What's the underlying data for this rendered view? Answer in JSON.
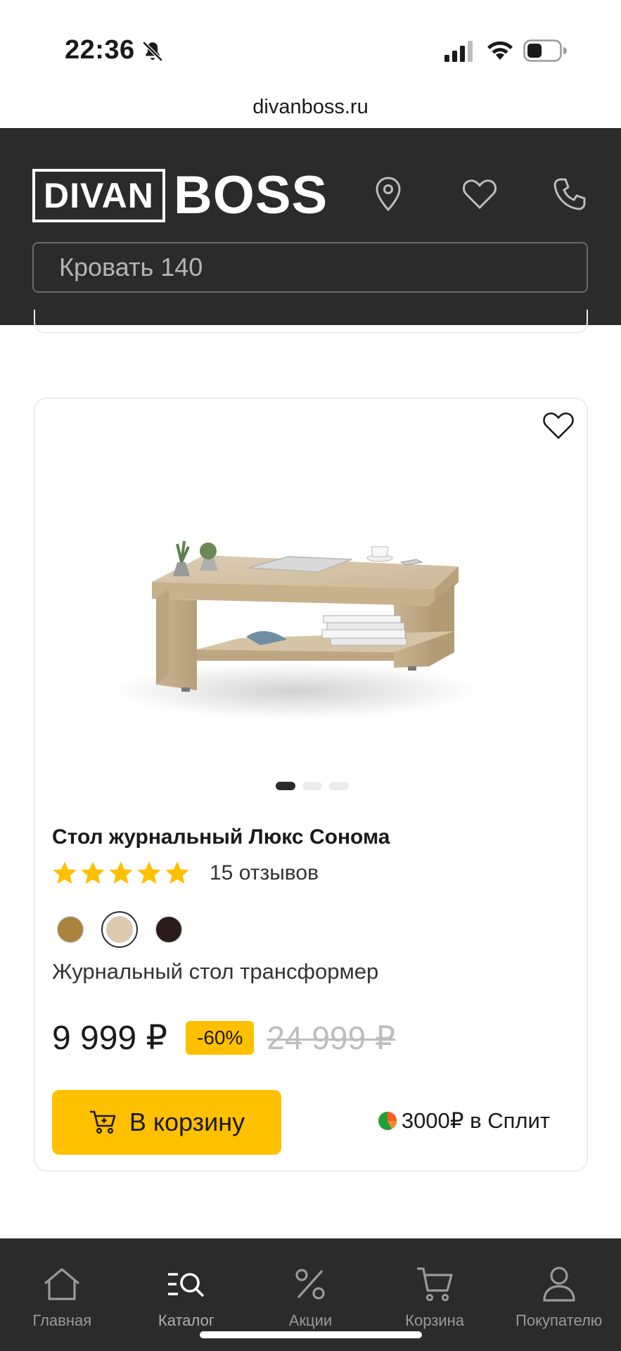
{
  "status_bar": {
    "time": "22:36",
    "icons": [
      "bell-slash-icon",
      "signal-icon",
      "wifi-icon",
      "battery-icon"
    ]
  },
  "browser": {
    "url": "divanboss.ru"
  },
  "header": {
    "logo_box_text": "DIVAN",
    "logo_text": "BOSS",
    "icons": [
      "location-pin-icon",
      "heart-icon",
      "phone-icon"
    ],
    "search_placeholder": "Кровать 140",
    "background_color": "#2b2b2b"
  },
  "product": {
    "title": "Стол журнальный Люкс Сонома",
    "rating": 5,
    "reviews": "15 отзывов",
    "image_slides": 3,
    "active_slide": 1,
    "colors": [
      {
        "hex": "#a9823d",
        "selected": false
      },
      {
        "hex": "#dfc9ad",
        "selected": true
      },
      {
        "hex": "#2a1c1a",
        "selected": false
      }
    ],
    "description": "Журнальный стол трансформер",
    "price": "9 999 ₽",
    "discount": "-60%",
    "old_price": "24 999 ₽",
    "cart_button": "В корзину",
    "split": "3000₽ в Сплит"
  },
  "bottom_nav": {
    "items": [
      {
        "label": "Главная",
        "icon": "home-icon"
      },
      {
        "label": "Каталог",
        "icon": "catalog-search-icon"
      },
      {
        "label": "Акции",
        "icon": "percent-icon"
      },
      {
        "label": "Корзина",
        "icon": "cart-icon"
      },
      {
        "label": "Покупателю",
        "icon": "user-icon"
      }
    ]
  },
  "colors": {
    "accent": "#ffc000",
    "dark": "#2b2b2b"
  }
}
